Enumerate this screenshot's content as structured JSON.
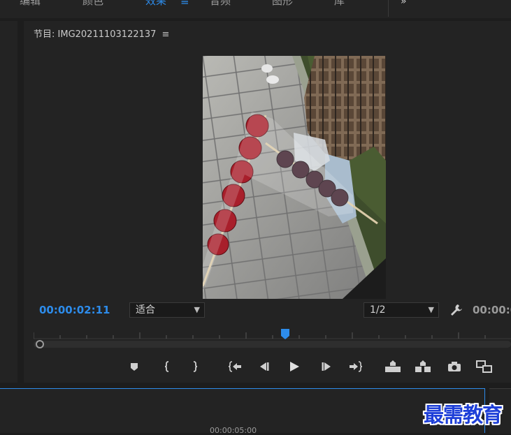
{
  "workspaces": {
    "tabs": [
      {
        "label": "编辑",
        "active": false
      },
      {
        "label": "颜色",
        "active": false
      },
      {
        "label": "效果",
        "active": true
      },
      {
        "label": "音频",
        "active": false
      },
      {
        "label": "图形",
        "active": false
      },
      {
        "label": "库",
        "active": false
      }
    ],
    "menu_glyph": "≡",
    "more_glyph": "»"
  },
  "monitor": {
    "title": "节目: IMG20211103122137",
    "title_menu_glyph": "≡",
    "current_time": "00:00:02:11",
    "zoom_select": "适合",
    "resolution_select": "1/2",
    "duration_time": "00:00:0",
    "playback_progress": 0.52
  },
  "timeline": {
    "ruler_time": "00:00:05:00"
  },
  "watermark": "最需教育",
  "colors": {
    "accent": "#2d8ceb",
    "panel": "#232323",
    "background": "#1d1d1d"
  },
  "icons": [
    "add-marker-icon",
    "mark-in-icon",
    "mark-out-icon",
    "go-to-in-icon",
    "step-back-icon",
    "play-icon",
    "step-forward-icon",
    "go-to-out-icon",
    "lift-icon",
    "extract-icon",
    "export-frame-icon",
    "button-editor-icon",
    "wrench-icon"
  ]
}
